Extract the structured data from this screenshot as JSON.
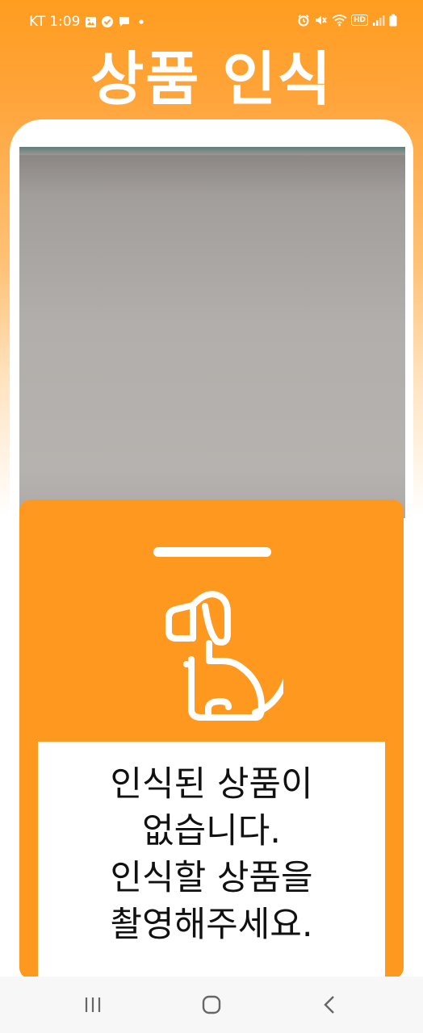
{
  "status_bar": {
    "carrier": "KT",
    "time": "1:09",
    "left_icons": [
      "image-icon",
      "check-circle-icon",
      "chat-icon",
      "dot-icon"
    ],
    "right_icons": [
      "alarm-icon",
      "mute-icon",
      "wifi-icon",
      "hd-icon",
      "signal-icon",
      "battery-icon"
    ],
    "hd_label": "HD"
  },
  "header": {
    "title": "상품 인식"
  },
  "bottom_sheet": {
    "message": "인식된 상품이\n없습니다.\n인식할 상품을\n촬영해주세요.",
    "icon": "dog-icon"
  },
  "navigation": {
    "buttons": [
      "recent-apps-icon",
      "home-icon",
      "back-icon"
    ]
  },
  "colors": {
    "accent": "#ff981f",
    "header_gradient_top": "#ff9d1f",
    "text": "#111111",
    "nav_background": "#f7f7f7"
  }
}
